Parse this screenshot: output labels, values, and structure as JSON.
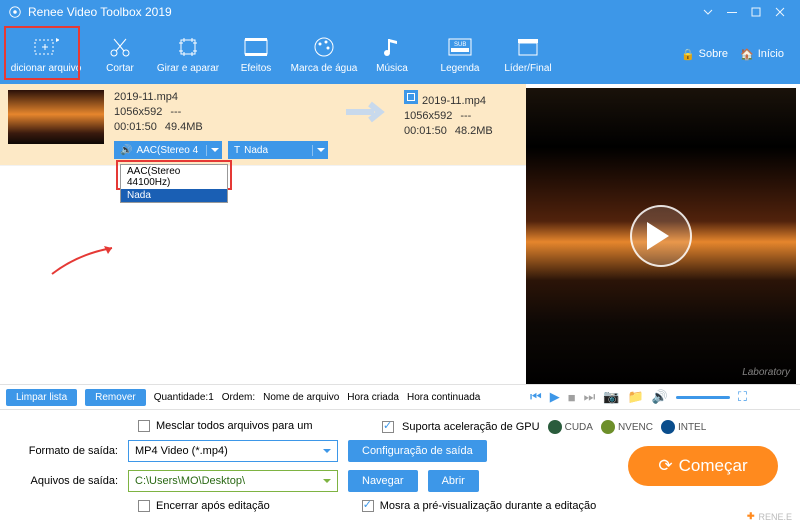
{
  "app_title": "Renee Video Toolbox 2019",
  "toolbar": {
    "items": [
      {
        "label": "dicionar arquivo"
      },
      {
        "label": "Cortar"
      },
      {
        "label": "Girar e aparar"
      },
      {
        "label": "Efeitos"
      },
      {
        "label": "Marca de água"
      },
      {
        "label": "Música"
      },
      {
        "label": "Legenda"
      },
      {
        "label": "Líder/Final"
      }
    ],
    "about": "Sobre",
    "home": "Início"
  },
  "file": {
    "in_name": "2019-11.mp4",
    "in_res": "1056x592",
    "in_dur": "00:01:50",
    "in_size": "49.4MB",
    "in_extra": "---",
    "out_name": "2019-11.mp4",
    "out_res": "1056x592",
    "out_dur": "00:01:50",
    "out_size": "48.2MB",
    "out_extra": "---",
    "audio_sel": "AAC(Stereo 4",
    "subtitle_sel": "Nada",
    "audio_options": [
      "AAC(Stereo 44100Hz)",
      "Nada"
    ]
  },
  "preview_watermark": "Laboratory",
  "midbar": {
    "clear": "Limpar lista",
    "remove": "Remover",
    "qty": "Quantidade:1",
    "order": "Ordem:",
    "sort_name": "Nome de arquivo",
    "sort_created": "Hora criada",
    "sort_cont": "Hora continuada"
  },
  "bottom": {
    "merge": "Mesclar todos arquivos para um",
    "gpu": "Suporta aceleração de GPU",
    "cuda": "CUDA",
    "nvenc": "NVENC",
    "intel": "INTEL",
    "fmt_label": "Formato de saída:",
    "fmt_value": "MP4 Video (*.mp4)",
    "out_cfg": "Configuração de saída",
    "path_label": "Aquivos de saída:",
    "path_value": "C:\\Users\\MO\\Desktop\\",
    "browse": "Navegar",
    "open": "Abrir",
    "close_after": "Encerrar após editação",
    "show_preview": "Mosra a pré-visualização durante a editação",
    "go": "Começar",
    "brand": "RENE.E"
  }
}
